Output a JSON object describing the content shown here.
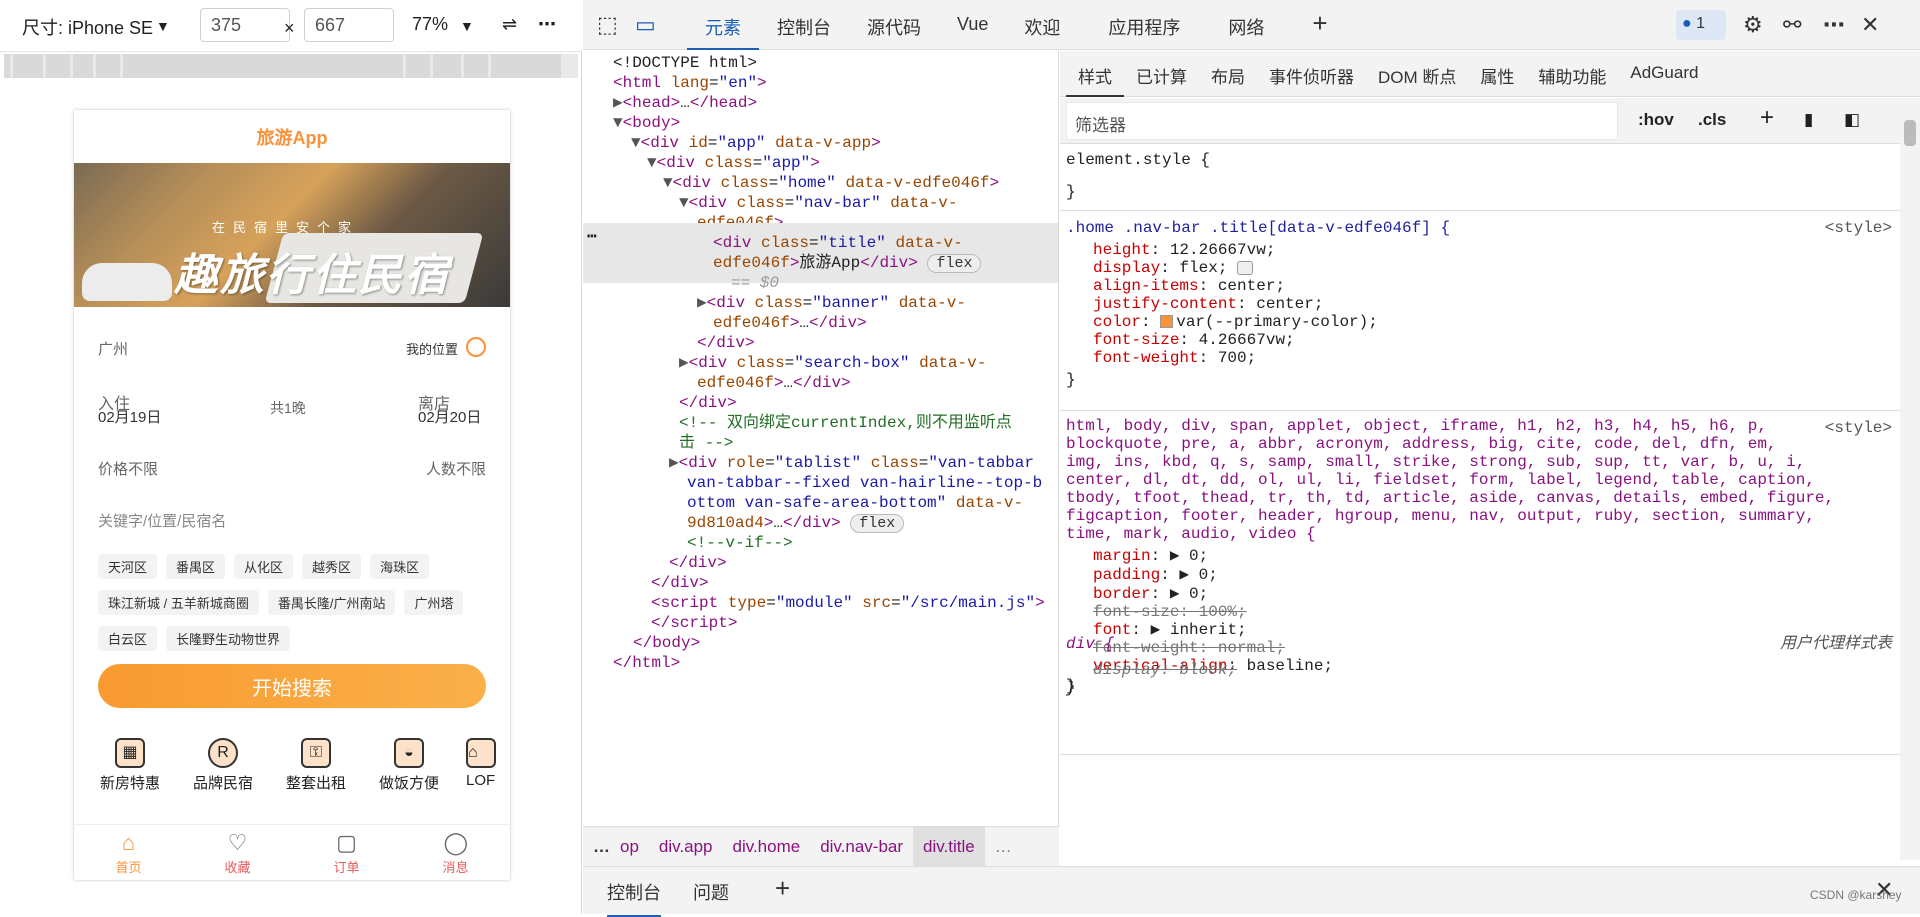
{
  "device_toolbar": {
    "size_label": "尺寸: iPhone SE",
    "width": "375",
    "times": "×",
    "height": "667",
    "zoom": "77%",
    "more": "⋮"
  },
  "phone": {
    "title": "旅游App",
    "banner_small": "在民宿里安个家",
    "banner_big": "趣旅行住民宿",
    "city": "广州",
    "my_location": "我的位置",
    "checkin_label": "入住",
    "checkin_date": "02月19日",
    "nights": "共1晚",
    "checkout_label": "离店",
    "checkout_date": "02月20日",
    "price": "价格不限",
    "people": "人数不限",
    "keyword_placeholder": "关键字/位置/民宿名",
    "tags": [
      "天河区",
      "番禺区",
      "从化区",
      "越秀区",
      "海珠区",
      "珠江新城 / 五羊新城商圈",
      "番禺长隆/广州南站",
      "广州塔",
      "白云区",
      "长隆野生动物世界"
    ],
    "search_button": "开始搜索",
    "categories": [
      "新房特惠",
      "品牌民宿",
      "整套出租",
      "做饭方便",
      "LOF"
    ],
    "tabbar": [
      "首页",
      "收藏",
      "订单",
      "消息"
    ]
  },
  "devtools": {
    "tabs": [
      "元素",
      "控制台",
      "源代码",
      "Vue",
      "欢迎",
      "应用程序",
      "网络"
    ],
    "issues_count": "1",
    "styles_tabs": [
      "样式",
      "已计算",
      "布局",
      "事件侦听器",
      "DOM 断点",
      "属性",
      "辅助功能",
      "AdGuard"
    ],
    "filter_placeholder": "筛选器",
    "hov": ":hov",
    "cls": ".cls",
    "breadcrumbs": [
      "…",
      "op",
      "div.app",
      "div.home",
      "div.nav-bar",
      "div.title",
      "…"
    ],
    "drawer_tabs": [
      "控制台",
      "问题"
    ],
    "watermark": "CSDN @karshey"
  },
  "dom": {
    "l1": "<!DOCTYPE html>",
    "eq0": "== $0",
    "flex": "flex",
    "comment": "<!-- 双向绑定currentIndex,则不用监听点",
    "comment2": "击 -->",
    "vif": "<!--v-if-->"
  },
  "styles": {
    "element_style": "element.style {",
    "close": "}",
    "rule1_selector": ".home .nav-bar .title[data-v-edfe046f] {",
    "rule1_src": "<style>",
    "rule1_props": [
      [
        "height",
        "12.26667vw;"
      ],
      [
        "display",
        "flex;"
      ],
      [
        "align-items",
        "center;"
      ],
      [
        "justify-content",
        "center;"
      ],
      [
        "color",
        "var(--primary-color);"
      ],
      [
        "font-size",
        "4.26667vw;"
      ],
      [
        "font-weight",
        "700;"
      ]
    ],
    "reset_selector": "html, body, div, span, applet, object, iframe, h1, h2, h3, h4, h5, h6, p,\nblockquote, pre, a, abbr, acronym, address, big, cite, code, del, dfn, em,\nimg, ins, kbd, q, s, samp, small, strike, strong, sub, sup, tt, var, b, u, i,\ncenter, dl, dt, dd, ol, ul, li, fieldset, form, label, legend, table, caption,\ntbody, tfoot, thead, tr, th, td, article, aside, canvas, details, embed, figure,\nfigcaption, footer, header, hgroup, menu, nav, output, ruby, section, summary,\ntime, mark, audio, video {",
    "reset_src": "<style>",
    "reset_props": [
      [
        "margin",
        "▶ 0;",
        false
      ],
      [
        "padding",
        "▶ 0;",
        false
      ],
      [
        "border",
        "▶ 0;",
        false
      ],
      [
        "font-size",
        "100%;",
        true
      ],
      [
        "font",
        "▶ inherit;",
        false
      ],
      [
        "font-weight",
        "normal;",
        true
      ],
      [
        "vertical-align",
        "baseline;",
        false
      ]
    ],
    "div_selector": "div {",
    "div_src": "用户代理样式表",
    "div_prop": [
      "display",
      "block;"
    ]
  }
}
